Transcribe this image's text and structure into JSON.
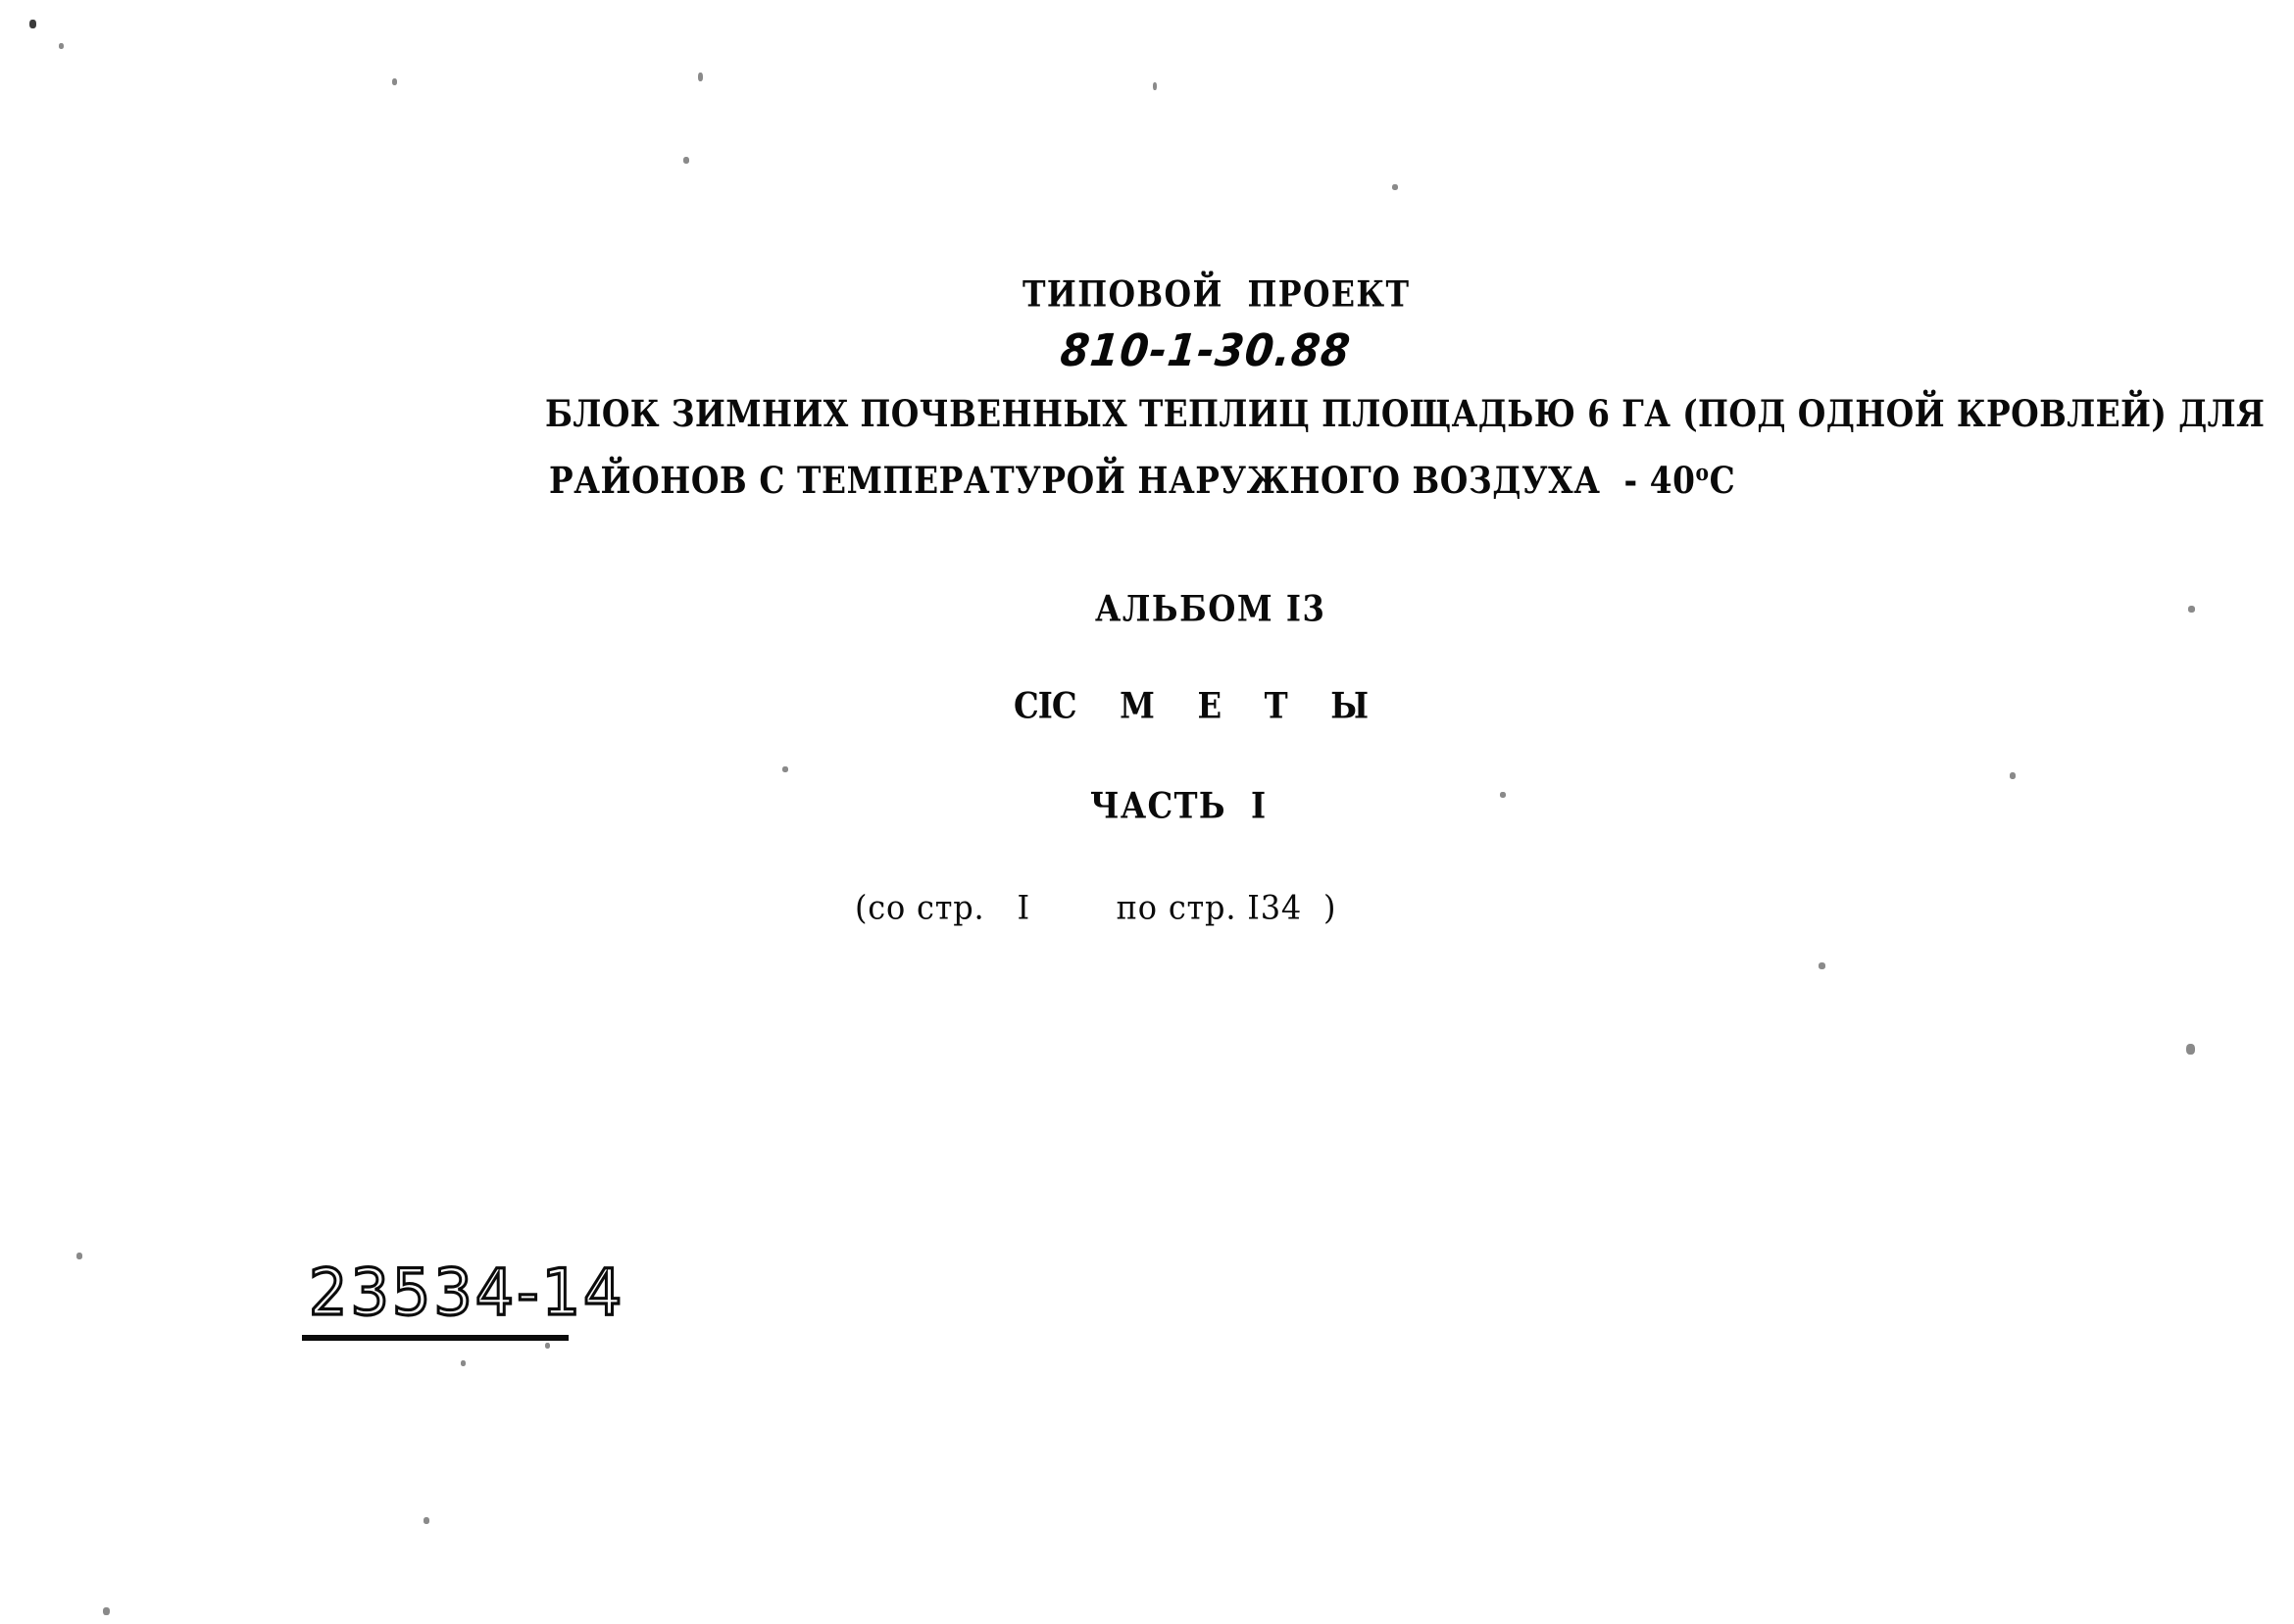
{
  "document": {
    "background_color": "#ffffff",
    "ink_color": "#0a0a0a",
    "header": {
      "type_label": "ТИПОВОЙ  ПРОЕКТ",
      "project_number": "810-1-30.88"
    },
    "description": {
      "line_1": "БЛОК ЗИМНИХ ПОЧВЕННЫХ ТЕПЛИЦ ПЛОЩАДЬЮ 6 ГА (ПОД ОДНОЙ КРОВЛЕЙ) ДЛЯ",
      "line_2_before_degree": "РАЙОНОВ С ТЕМПЕРАТУРОЙ НАРУЖНОГО ВОЗДУХА  - 40",
      "line_2_degree": "о",
      "line_2_after_degree": "С"
    },
    "album": {
      "label": "АЛЬБОМ I3"
    },
    "section": {
      "prefix": "СI",
      "title": "С М Е Т Ы"
    },
    "part": {
      "label": "ЧАСТЬ  I"
    },
    "page_range": {
      "text": "(со стр.   I        по стр. I34  )"
    },
    "archive_stamp": {
      "number": "23534-14"
    }
  }
}
